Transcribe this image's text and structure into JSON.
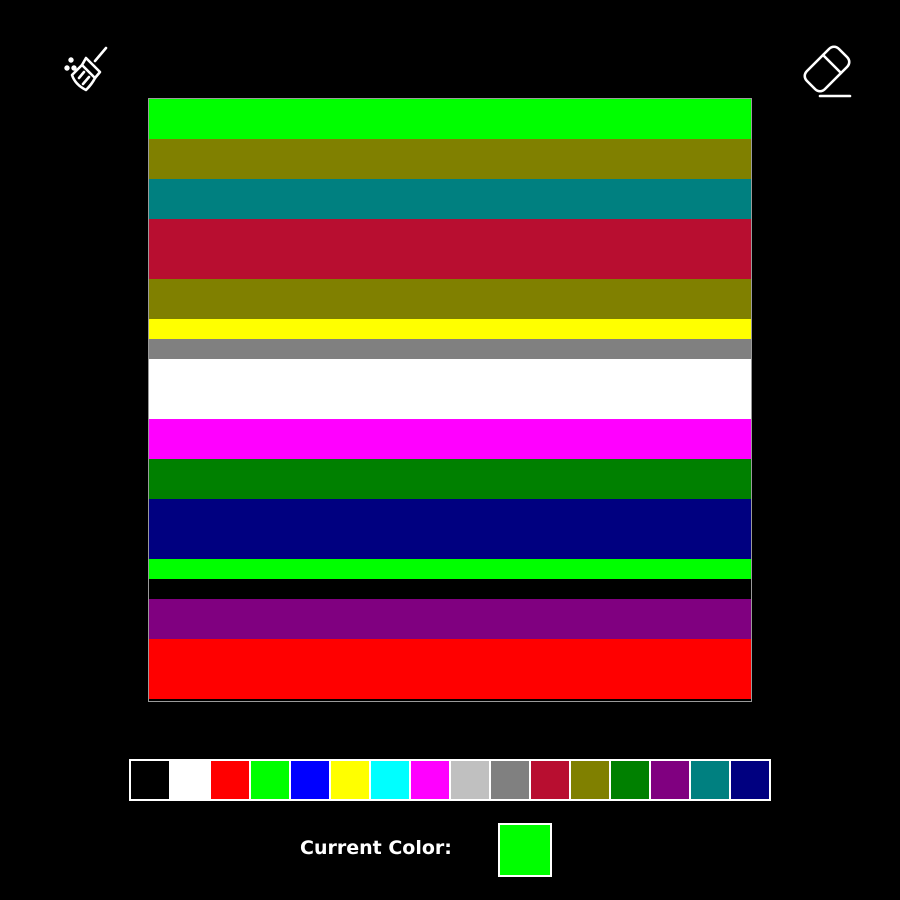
{
  "tools": [
    {
      "name": "broom-clear-icon"
    },
    {
      "name": "eraser-icon"
    }
  ],
  "canvas": {
    "background": "#000000",
    "stripes": [
      {
        "color": "#00ff00",
        "rows": 2
      },
      {
        "color": "#808000",
        "rows": 2
      },
      {
        "color": "#008080",
        "rows": 2
      },
      {
        "color": "#b80e30",
        "rows": 3
      },
      {
        "color": "#808000",
        "rows": 2
      },
      {
        "color": "#ffff00",
        "rows": 1
      },
      {
        "color": "#808080",
        "rows": 1
      },
      {
        "color": "#ffffff",
        "rows": 3
      },
      {
        "color": "#ff00ff",
        "rows": 2
      },
      {
        "color": "#008000",
        "rows": 2
      },
      {
        "color": "#000080",
        "rows": 3
      },
      {
        "color": "#00ff00",
        "rows": 1
      },
      {
        "color": "#000000",
        "rows": 1
      },
      {
        "color": "#800080",
        "rows": 2
      },
      {
        "color": "#ff0000",
        "rows": 3
      }
    ]
  },
  "palette": {
    "colors": [
      "#000000",
      "#ffffff",
      "#ff0000",
      "#00ff00",
      "#0000ff",
      "#ffff00",
      "#00ffff",
      "#ff00ff",
      "#c0c0c0",
      "#808080",
      "#b80e30",
      "#808000",
      "#008000",
      "#800080",
      "#008080",
      "#000080"
    ]
  },
  "current": {
    "label": "Current Color:",
    "color": "#00ff00"
  }
}
